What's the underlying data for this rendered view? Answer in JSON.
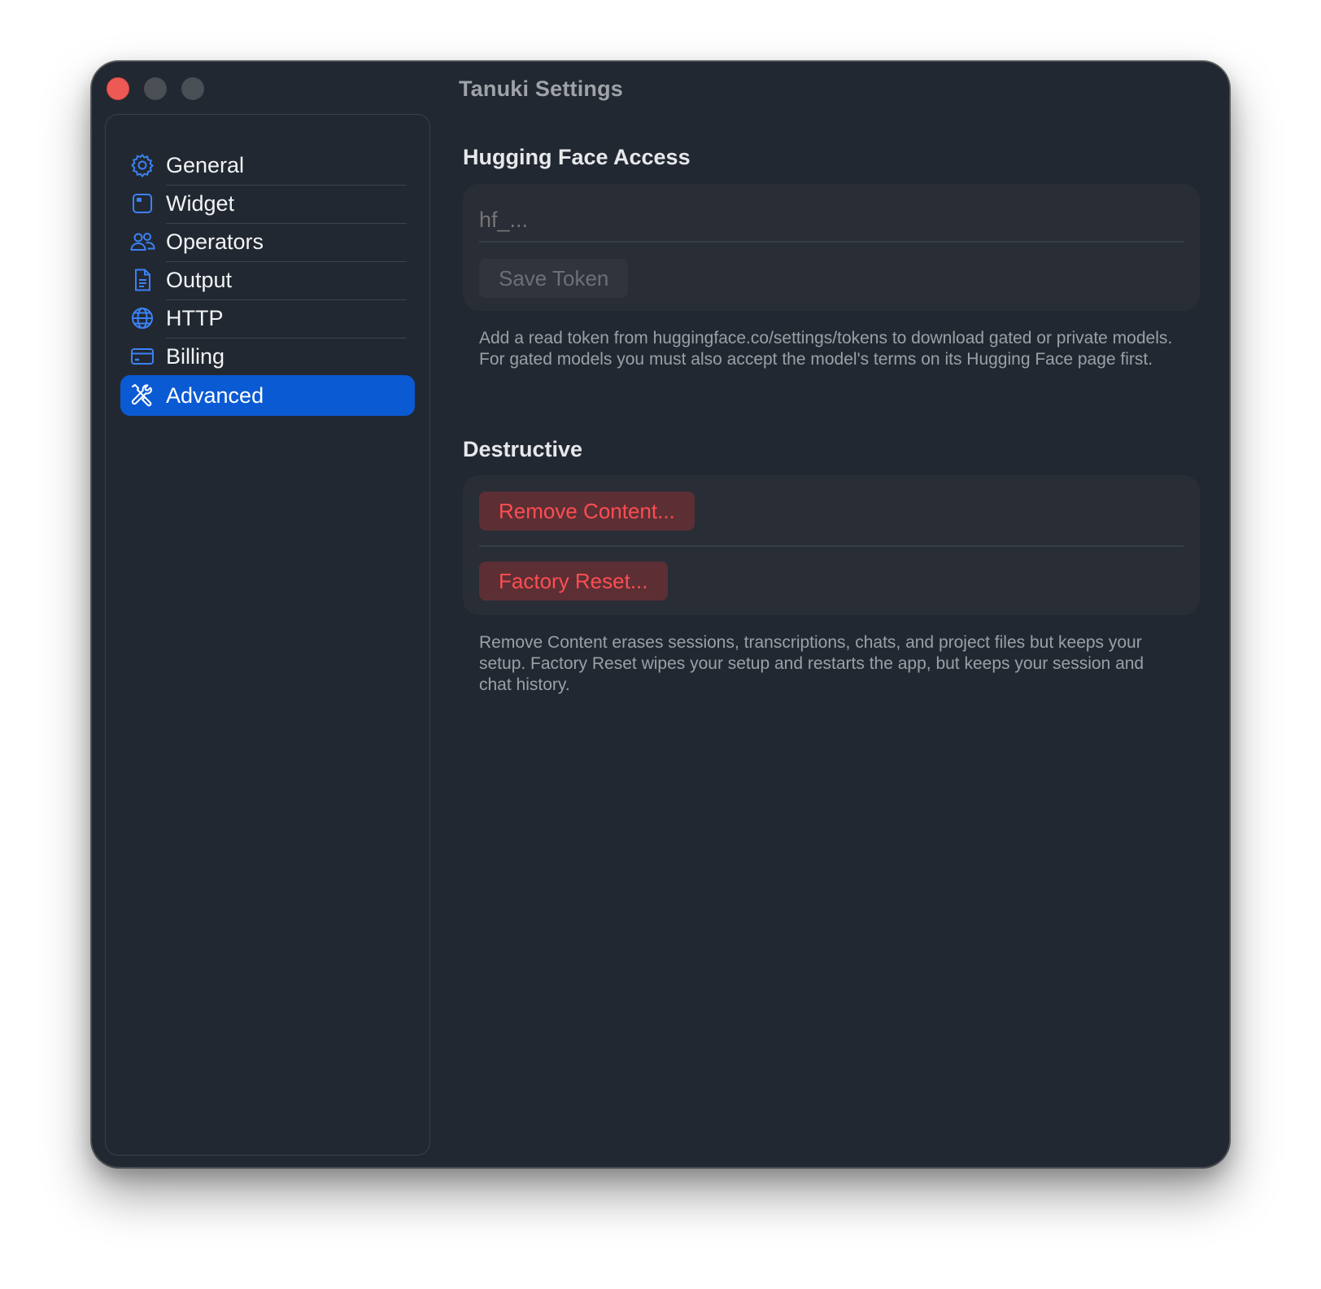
{
  "window": {
    "title": "Tanuki Settings"
  },
  "sidebar": {
    "items": [
      {
        "label": "General",
        "icon": "gear-icon",
        "selected": false
      },
      {
        "label": "Widget",
        "icon": "widget-icon",
        "selected": false
      },
      {
        "label": "Operators",
        "icon": "people-icon",
        "selected": false
      },
      {
        "label": "Output",
        "icon": "document-icon",
        "selected": false
      },
      {
        "label": "HTTP",
        "icon": "globe-icon",
        "selected": false
      },
      {
        "label": "Billing",
        "icon": "credit-card-icon",
        "selected": false
      },
      {
        "label": "Advanced",
        "icon": "wrench-screwdriver-icon",
        "selected": true
      }
    ]
  },
  "hugging_face": {
    "title": "Hugging Face Access",
    "token_placeholder": "hf_...",
    "token_value": "",
    "save_label": "Save Token",
    "help_text": "Add a read token from huggingface.co/settings/tokens to download gated or private models. For gated models you must also accept the model's terms on its Hugging Face page first."
  },
  "destructive": {
    "title": "Destructive",
    "remove_label": "Remove Content...",
    "reset_label": "Factory Reset...",
    "help_text": "Remove Content erases sessions, transcriptions, chats, and project files but keeps your setup. Factory Reset wipes your setup and restarts the app, but keeps your session and chat history."
  },
  "colors": {
    "accent": "#0a5ad3",
    "danger_text": "#ff4d52",
    "danger_bg": "#5b2f34",
    "window_bg": "#222831",
    "card_bg": "#282d36"
  }
}
